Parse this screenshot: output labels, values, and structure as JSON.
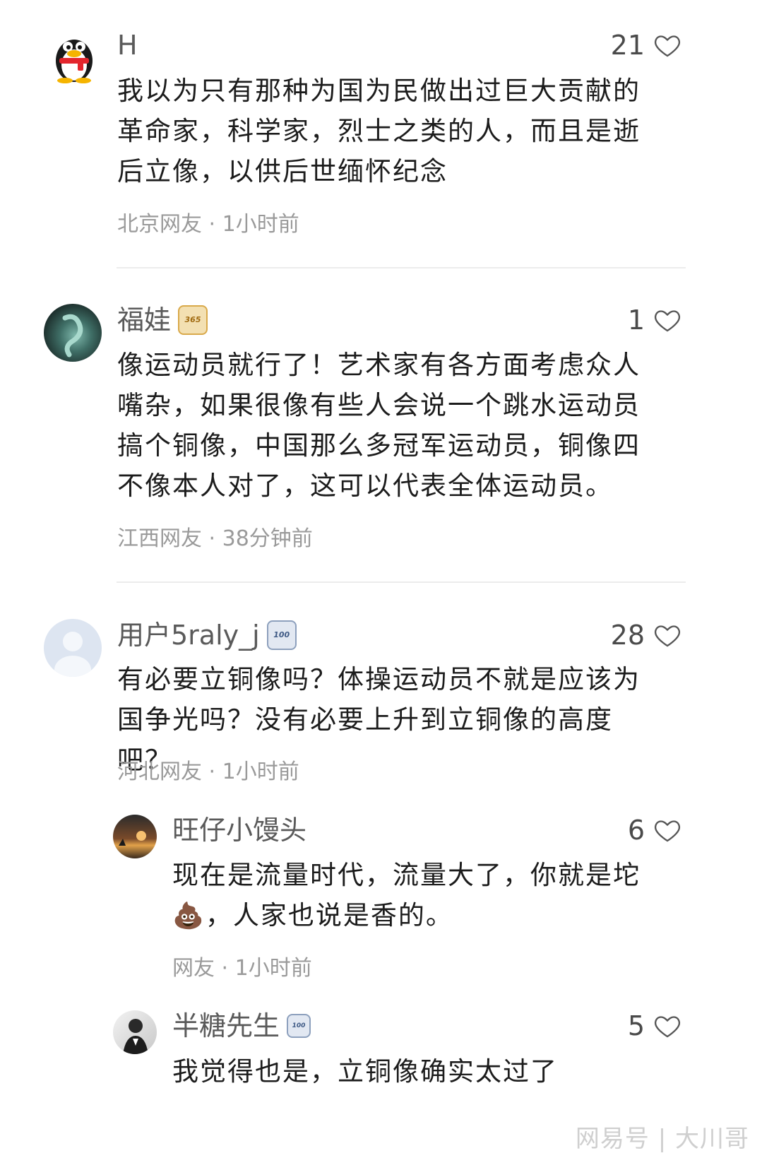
{
  "comments": [
    {
      "username": "H",
      "likes": "21",
      "text": "我以为只有那种为国为民做出过巨大贡献的革命家，科学家，烈士之类的人，而且是逝后立像，以供后世缅怀纪念",
      "meta": "北京网友 · 1小时前"
    },
    {
      "username": "福娃",
      "badge": "365",
      "likes": "1",
      "text": "像运动员就行了！艺术家有各方面考虑众人嘴杂，如果很像有些人会说一个跳水运动员搞个铜像，中国那么多冠军运动员，铜像四不像本人对了，这可以代表全体运动员。",
      "meta": "江西网友 · 38分钟前"
    },
    {
      "username": "用户5raly_j",
      "badge": "100",
      "likes": "28",
      "text": "有必要立铜像吗？体操运动员不就是应该为国争光吗？没有必要上升到立铜像的高度吧？",
      "meta": "河北网友 · 1小时前"
    }
  ],
  "replies": [
    {
      "username": "旺仔小馒头",
      "likes": "6",
      "text_before": "现在是流量时代，流量大了，你就是坨",
      "emoji": "💩",
      "text_after": "，人家也说是香的。",
      "meta": "网友 · 1小时前"
    },
    {
      "username": "半糖先生",
      "badge": "100",
      "likes": "5",
      "text": "我觉得也是，立铜像确实太过了"
    }
  ],
  "watermark": "网易号 | 大川哥",
  "colors": {
    "text": "#1c1c1c",
    "muted": "#9a9a9a",
    "name": "#5a5a5a"
  }
}
